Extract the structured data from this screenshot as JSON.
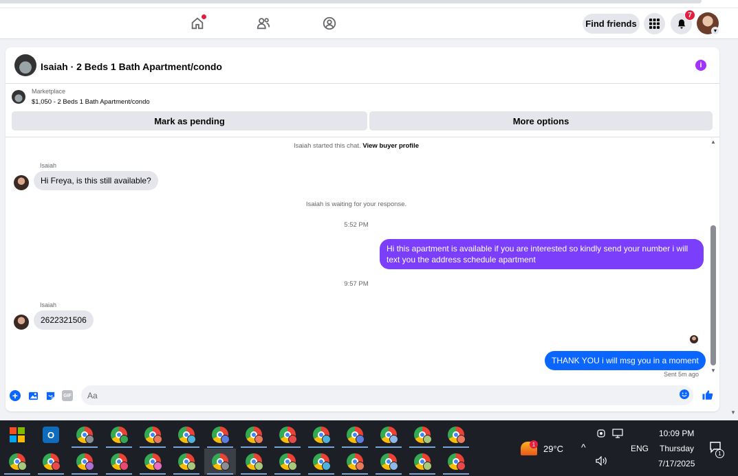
{
  "header": {
    "find_friends": "Find friends",
    "notification_count": "7"
  },
  "chat": {
    "title": "Isaiah · 2 Beds 1 Bath Apartment/condo",
    "marketplace_label": "Marketplace",
    "listing": "$1,050 - 2 Beds 1 Bath Apartment/condo",
    "mark_pending": "Mark as pending",
    "more_options": "More options",
    "started_text": "Isaiah started this chat.",
    "view_buyer_profile": "View buyer profile",
    "messages": [
      {
        "sender": "Isaiah",
        "text": "Hi Freya, is this still available?"
      },
      {
        "system": "Isaiah is waiting for your response."
      },
      {
        "time": "5:52 PM"
      },
      {
        "text": "Hi this apartment is available if you are interested so kindly send your number i will text you the address schedule apartment"
      },
      {
        "time": "9:57 PM"
      },
      {
        "sender": "Isaiah",
        "text": "2622321506"
      },
      {
        "text": "THANK YOU i will msg you in a moment"
      }
    ],
    "sent_status": "Sent 5m ago",
    "composer_placeholder": "Aa",
    "gif_label": "GIF"
  },
  "taskbar": {
    "temperature": "29°C",
    "weather_badge": "1",
    "language": "ENG",
    "time": "10:09 PM",
    "day": "Thursday",
    "date": "7/17/2025",
    "notification_badge": "1"
  }
}
